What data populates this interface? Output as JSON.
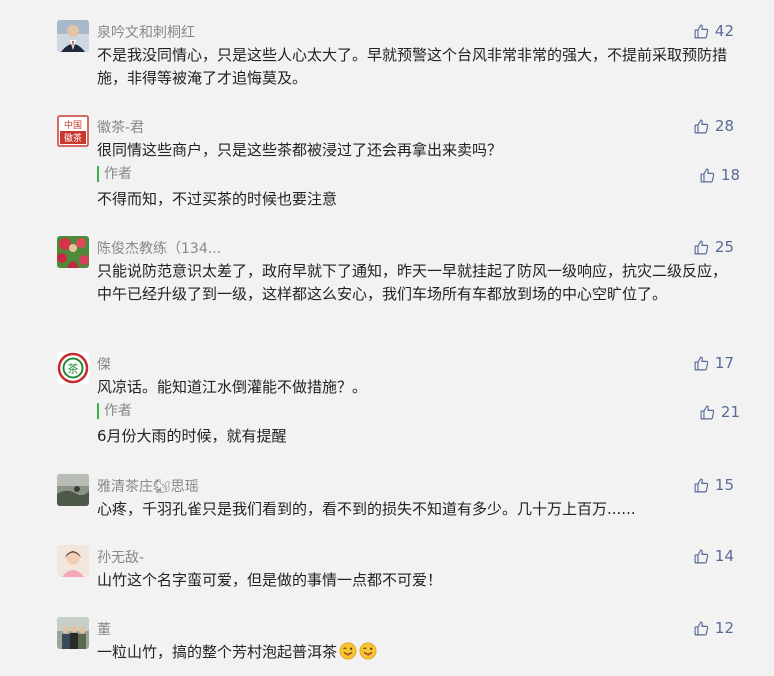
{
  "comments": [
    {
      "name": "泉吟文和刺桐红",
      "text": "不是我没同情心，只是这些人心太大了。早就预警这个台风非常非常的强大，不提前采取预防措施，非得等被淹了才追悔莫及。",
      "likes": "42",
      "avatar": "man-in-suit-avatar"
    },
    {
      "name": "徽茶-君",
      "text": "很同情这些商户，只是这些茶都被浸过了还会再拿出来卖吗？",
      "likes": "28",
      "avatar": "china-tea-logo-avatar",
      "avatar_text": "中国徽茶",
      "reply": {
        "author_label": "作者",
        "text": "不得而知，不过买茶的时候也要注意",
        "likes": "18"
      }
    },
    {
      "name": "陈俊杰教练（134...",
      "text": "只能说防范意识太差了，政府早就下了通知，昨天一早就挂起了防风一级响应，抗灾二级反应，中午已经升级了到一级，这样都这么安心，我们车场所有车都放到场的中心空旷位了。",
      "likes": "25",
      "avatar": "flower-photo-avatar"
    },
    {
      "name": "傑",
      "text": "风凉话。能知道江水倒灌能不做措施？。",
      "likes": "17",
      "avatar": "tea-emblem-avatar",
      "avatar_text": "茶",
      "reply": {
        "author_label": "作者",
        "text": "6月份大雨的时候，就有提醒",
        "likes": "21"
      }
    },
    {
      "name": "雅清茶庄🐿思瑶",
      "text": "心疼，千羽孔雀只是我们看到的，看不到的损失不知道有多少。几十万上百万......",
      "likes": "15",
      "avatar": "landscape-photo-avatar"
    },
    {
      "name": "孙无敌-",
      "text": "山竹这个名字蛮可爱，但是做的事情一点都不可爱！",
      "likes": "14",
      "avatar": "portrait-photo-avatar"
    },
    {
      "name": "董",
      "text": "一粒山竹，搞的整个芳村泡起普洱茶",
      "likes": "12",
      "avatar": "group-photo-avatar",
      "emojis": [
        "tongue-wink-emoji",
        "tongue-wink-emoji"
      ]
    }
  ],
  "colors": {
    "background": "#f2f2f2",
    "name": "#888888",
    "text": "#222222",
    "like": "#576b95",
    "author_bar": "#3bb04b"
  }
}
